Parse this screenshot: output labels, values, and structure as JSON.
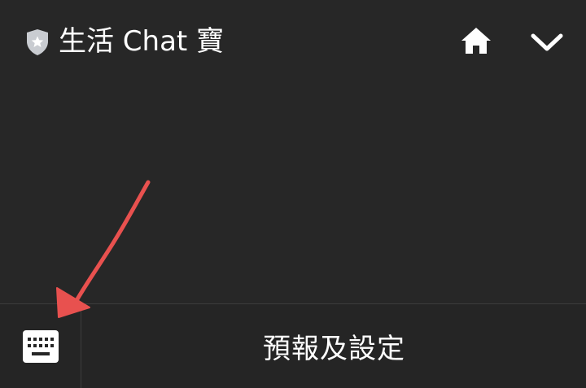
{
  "header": {
    "title": "生活 Chat 寶",
    "badge_icon": "verified-shield-star-icon",
    "home_icon": "home-icon",
    "collapse_icon": "chevron-down-icon"
  },
  "bottom_bar": {
    "keyboard_icon": "keyboard-icon",
    "menu_label": "預報及設定"
  },
  "annotation": {
    "type": "red-arrow",
    "color": "#e8514f",
    "points_to": "keyboard-toggle"
  },
  "colors": {
    "background": "#272727",
    "text": "#ffffff",
    "badge": "#c9ccd1",
    "divider": "#3c3c3c"
  }
}
